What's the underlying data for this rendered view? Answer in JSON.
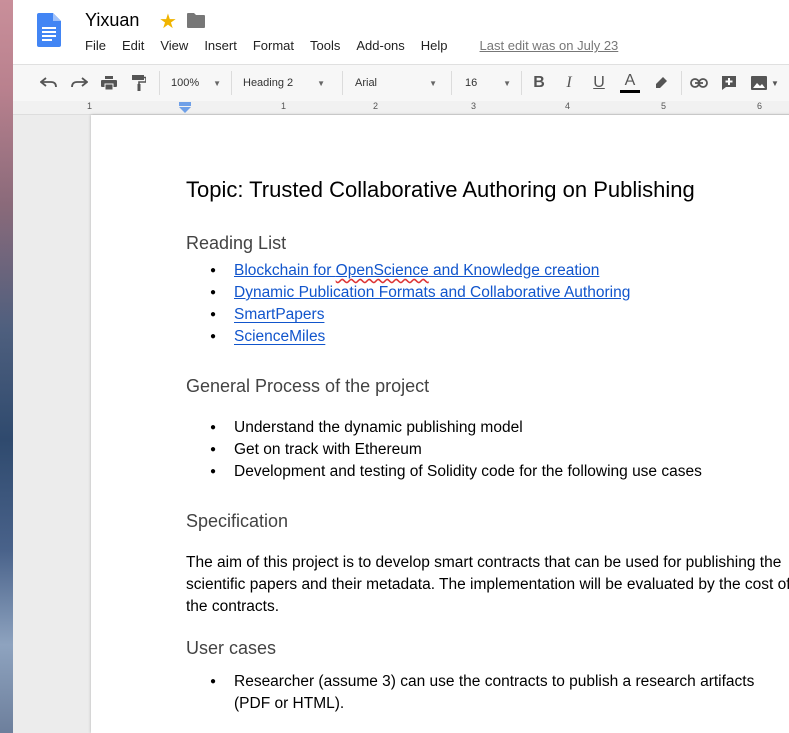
{
  "document": {
    "title": "Yixuan",
    "last_edit": "Last edit was on July 23"
  },
  "menu": [
    "File",
    "Edit",
    "View",
    "Insert",
    "Format",
    "Tools",
    "Add-ons",
    "Help"
  ],
  "toolbar": {
    "zoom": "100%",
    "style": "Heading 2",
    "font": "Arial",
    "size": "16",
    "text_color": "#000000",
    "icons": [
      "undo-icon",
      "redo-icon",
      "print-icon",
      "paint-format-icon",
      "bold-icon",
      "italic-icon",
      "underline-icon",
      "text-color-icon",
      "highlight-icon",
      "link-icon",
      "comment-icon",
      "image-icon"
    ]
  },
  "ruler": {
    "numbers": [
      "1",
      "1",
      "2",
      "3",
      "4",
      "5",
      "6"
    ]
  },
  "body": {
    "title": "Topic: Trusted Collaborative Authoring on Publishing",
    "reading_list": {
      "heading": "Reading List",
      "items": [
        "Blockchain for OpenScience and Knowledge creation",
        "Dynamic Publication Formats and Collaborative Authoring",
        "SmartPapers",
        "ScienceMiles"
      ]
    },
    "process": {
      "heading": "General Process of the project",
      "items": [
        "Understand the dynamic publishing model",
        "Get on track with Ethereum",
        "Development and testing of Solidity code for the following use cases"
      ]
    },
    "specification": {
      "heading": "Specification",
      "text": "The aim of this project is to develop smart contracts that can be used for publishing the scientific papers and their metadata. The implementation will be evaluated by the cost of the contracts."
    },
    "user_cases": {
      "heading": "User cases",
      "items": [
        "Researcher (assume 3) can use the contracts to publish a research artifacts (PDF or HTML)."
      ]
    }
  },
  "colors": {
    "link": "#1155cc",
    "star": "#f0b400",
    "docs_blue": "#4285f4"
  }
}
